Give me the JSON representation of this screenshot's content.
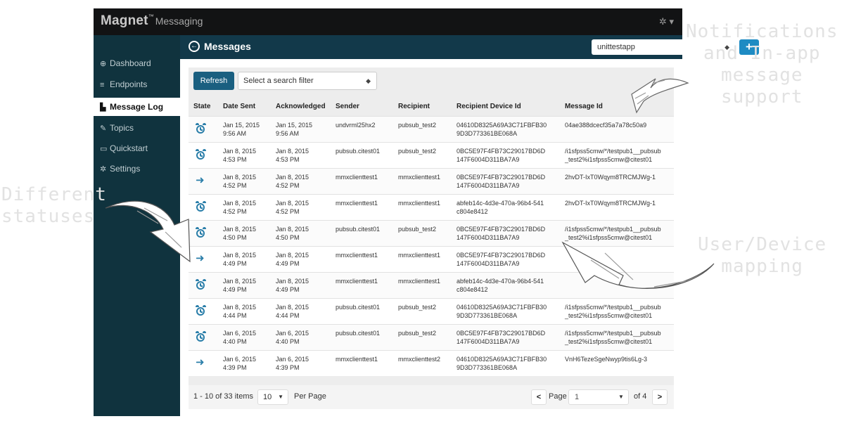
{
  "brand": {
    "name": "Magnet",
    "tm": "™",
    "sub": "Messaging",
    "settings_icon": "gear-icon"
  },
  "sidebar": {
    "items": [
      {
        "label": "Dashboard",
        "icon": "dashboard-icon",
        "glyph": "⊕"
      },
      {
        "label": "Endpoints",
        "icon": "list-icon",
        "glyph": "≡"
      },
      {
        "label": "Message Log",
        "icon": "chart-icon",
        "glyph": "▙",
        "active": true
      },
      {
        "label": "Topics",
        "icon": "edit-icon",
        "glyph": "✎"
      },
      {
        "label": "Quickstart",
        "icon": "monitor-icon",
        "glyph": "▭"
      },
      {
        "label": "Settings",
        "icon": "gear-icon",
        "glyph": "✲"
      }
    ]
  },
  "header": {
    "title": "Messages",
    "back_icon": "circle-arrow-left-icon",
    "app_selected": "unittestapp",
    "add_label": "+"
  },
  "toolbar": {
    "refresh_label": "Refresh",
    "filter_placeholder": "Select a search filter"
  },
  "table": {
    "columns": [
      "State",
      "Date Sent",
      "Acknowledged",
      "Sender",
      "Recipient",
      "Recipient Device Id",
      "Message Id"
    ],
    "rows": [
      {
        "state": "clock",
        "date": [
          "Jan 15, 2015",
          "9:56 AM"
        ],
        "ack": [
          "Jan 15, 2015",
          "9:56 AM"
        ],
        "sender": "undvrml25hx2",
        "recipient": "pubsub_test2",
        "device": [
          "04610D8325A69A3C71FBFB30",
          "9D3D773361BE068A"
        ],
        "msg": [
          "04ae388dcecf35a7a78c50a9",
          ""
        ]
      },
      {
        "state": "clock",
        "date": [
          "Jan 8, 2015",
          "4:53 PM"
        ],
        "ack": [
          "Jan 8, 2015",
          "4:53 PM"
        ],
        "sender": "pubsub.citest01",
        "recipient": "pubsub_test2",
        "device": [
          "0BC5E97F4FB73C29017BD6D",
          "147F6004D311BA7A9"
        ],
        "msg": [
          "/i1sfpss5cmw/*/testpub1__pubsub",
          "_test2%i1sfpss5cmw@citest01"
        ]
      },
      {
        "state": "arrow",
        "date": [
          "Jan 8, 2015",
          "4:52 PM"
        ],
        "ack": [
          "Jan 8, 2015",
          "4:52 PM"
        ],
        "sender": "mmxclienttest1",
        "recipient": "mmxclienttest1",
        "device": [
          "0BC5E97F4FB73C29017BD6D",
          "147F6004D311BA7A9"
        ],
        "msg": [
          "2hvDT-IxT0Wqym8TRCMJWg-1",
          ""
        ]
      },
      {
        "state": "clock",
        "date": [
          "Jan 8, 2015",
          "4:52 PM"
        ],
        "ack": [
          "Jan 8, 2015",
          "4:52 PM"
        ],
        "sender": "mmxclienttest1",
        "recipient": "mmxclienttest1",
        "device": [
          "abfeb14c-4d3e-470a-96b4-541",
          "c804e8412"
        ],
        "msg": [
          "2hvDT-IxT0Wqym8TRCMJWg-1",
          ""
        ]
      },
      {
        "state": "clock",
        "date": [
          "Jan 8, 2015",
          "4:50 PM"
        ],
        "ack": [
          "Jan 8, 2015",
          "4:50 PM"
        ],
        "sender": "pubsub.citest01",
        "recipient": "pubsub_test2",
        "device": [
          "0BC5E97F4FB73C29017BD6D",
          "147F6004D311BA7A9"
        ],
        "msg": [
          "/i1sfpss5cmw/*/testpub1__pubsub",
          "_test2%i1sfpss5cmw@citest01"
        ]
      },
      {
        "state": "arrow",
        "date": [
          "Jan 8, 2015",
          "4:49 PM"
        ],
        "ack": [
          "Jan 8, 2015",
          "4:49 PM"
        ],
        "sender": "mmxclienttest1",
        "recipient": "mmxclienttest1",
        "device": [
          "0BC5E97F4FB73C29017BD6D",
          "147F6004D311BA7A9"
        ],
        "msg": [
          "",
          ""
        ]
      },
      {
        "state": "clock",
        "date": [
          "Jan 8, 2015",
          "4:49 PM"
        ],
        "ack": [
          "Jan 8, 2015",
          "4:49 PM"
        ],
        "sender": "mmxclienttest1",
        "recipient": "mmxclienttest1",
        "device": [
          "abfeb14c-4d3e-470a-96b4-541",
          "c804e8412"
        ],
        "msg": [
          "",
          ""
        ]
      },
      {
        "state": "clock",
        "date": [
          "Jan 8, 2015",
          "4:44 PM"
        ],
        "ack": [
          "Jan 8, 2015",
          "4:44 PM"
        ],
        "sender": "pubsub.citest01",
        "recipient": "pubsub_test2",
        "device": [
          "04610D8325A69A3C71FBFB30",
          "9D3D773361BE068A"
        ],
        "msg": [
          "/i1sfpss5cmw/*/testpub1__pubsub",
          "_test2%i1sfpss5cmw@citest01"
        ]
      },
      {
        "state": "clock",
        "date": [
          "Jan 6, 2015",
          "4:40 PM"
        ],
        "ack": [
          "Jan 6, 2015",
          "4:40 PM"
        ],
        "sender": "pubsub.citest01",
        "recipient": "pubsub_test2",
        "device": [
          "0BC5E97F4FB73C29017BD6D",
          "147F6004D311BA7A9"
        ],
        "msg": [
          "/i1sfpss5cmw/*/testpub1__pubsub",
          "_test2%i1sfpss5cmw@citest01"
        ]
      },
      {
        "state": "arrow",
        "date": [
          "Jan 6, 2015",
          "4:39 PM"
        ],
        "ack": [
          "Jan 6, 2015",
          "4:39 PM"
        ],
        "sender": "mmxclienttest1",
        "recipient": "mmxclienttest2",
        "device": [
          "04610D8325A69A3C71FBFB30",
          "9D3D773361BE068A"
        ],
        "msg": [
          "VnH6TezeSgeNwyp9tis6Lg-3",
          ""
        ]
      }
    ]
  },
  "pagination": {
    "summary": "1 - 10 of 33 items",
    "page_size": "10",
    "per_page_label": "Per Page",
    "page_label": "Page",
    "page_value": "1",
    "of_label": "of 4",
    "prev_icon": "chevron-left-icon",
    "next_icon": "chevron-right-icon"
  },
  "annotations": {
    "notifications": [
      "Notifications",
      "and In-app",
      "message",
      "support"
    ],
    "statuses": [
      "Different",
      "statuses"
    ],
    "mapping": [
      "User/Device",
      "mapping"
    ]
  },
  "colors": {
    "topbar": "#121314",
    "sidebar": "#10333e",
    "header": "#12394a",
    "accent": "#1e8bc3",
    "status_icon": "#2a7ea9",
    "annotation": "#e2e2e2"
  }
}
